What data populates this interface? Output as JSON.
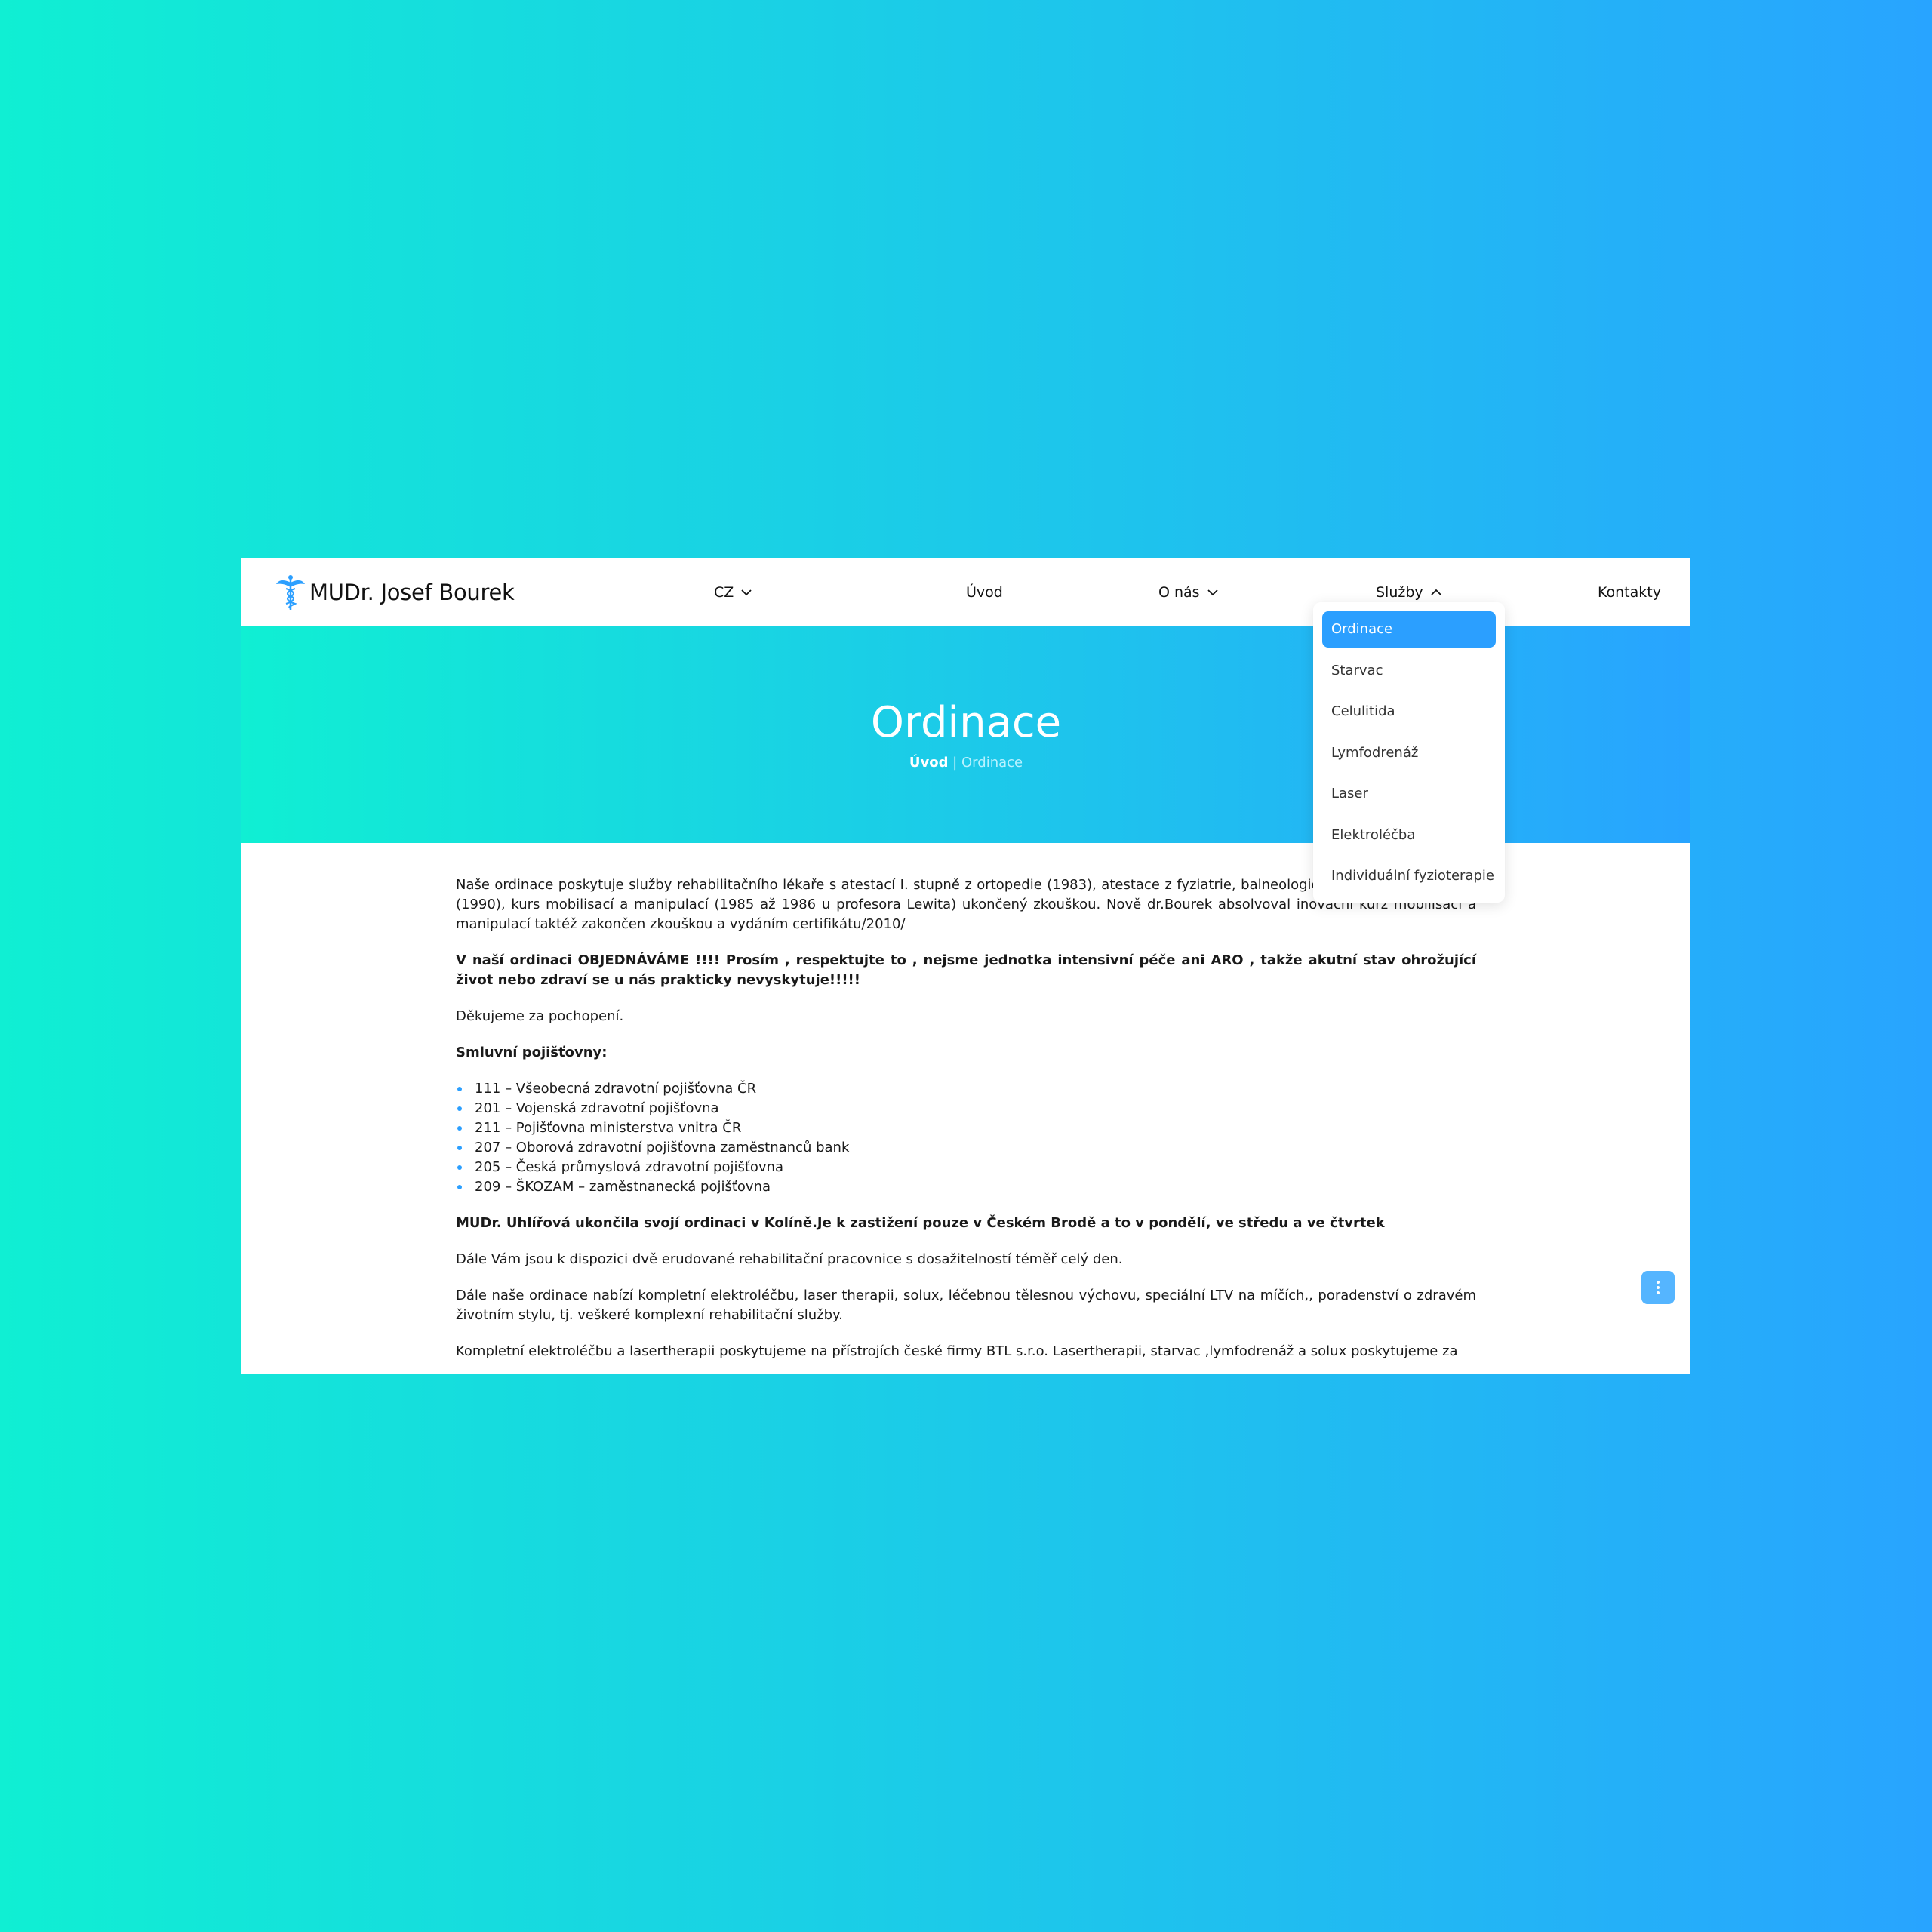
{
  "header": {
    "logo_text": "MUDr. Josef Bourek",
    "nav": {
      "lang": "CZ",
      "home": "Úvod",
      "about": "O nás",
      "services": "Služby",
      "contacts": "Kontakty"
    }
  },
  "dropdown": {
    "items": [
      "Ordinace",
      "Starvac",
      "Celulitida",
      "Lymfodrenáž",
      "Laser",
      "Elektroléčba",
      "Individuální fyzioterapie"
    ],
    "active_index": 0
  },
  "hero": {
    "title": "Ordinace",
    "breadcrumb_home": "Úvod",
    "breadcrumb_sep": " | ",
    "breadcrumb_current": "Ordinace"
  },
  "content": {
    "p1": "Naše ordinace poskytuje služby rehabilitačního lékaře s atestací I. stupně z ortopedie (1983), atestace z fyziatrie, balneologie a léčebné rehabilitace (1990), kurs mobilisací a manipulací (1985 až 1986 u profesora Lewita) ukončený zkouškou. Nově dr.Bourek absolvoval inovační kurz mobilisací a manipulací taktéž zakončen zkouškou a vydáním certifikátu/2010/",
    "p2": "V naší ordinaci OBJEDNÁVÁME !!!! Prosím , respektujte to , nejsme jednotka intensivní péče ani ARO , takže akutní stav ohrožující život nebo zdraví se u nás prakticky nevyskytuje!!!!!",
    "p3": "Děkujeme za pochopení.",
    "insurers_heading": "Smluvní pojišťovny:",
    "insurers": [
      "111 – Všeobecná zdravotní pojišťovna ČR",
      "201 – Vojenská zdravotní pojišťovna",
      "211 – Pojišťovna ministerstva vnitra ČR",
      "207 – Oborová zdravotní pojišťovna zaměstnanců bank",
      "205 – Česká průmyslová zdravotní pojišťovna",
      "209 – ŠKOZAM – zaměstnanecká pojišťovna"
    ],
    "p4": "MUDr. Uhlířová ukončila svojí ordinaci v Kolíně.Je k zastižení pouze v Českém Brodě a to v pondělí, ve středu a ve čtvrtek",
    "p5": "Dále Vám jsou k dispozici dvě erudované rehabilitační pracovnice s dosažitelností téměř celý den.",
    "p6": "Dále naše ordinace nabízí kompletní elektroléčbu, laser therapii, solux, léčebnou tělesnou výchovu, speciální LTV na míčích,, poradenství o zdravém životním stylu, tj. veškeré komplexní rehabilitační služby.",
    "p7": "Kompletní elektroléčbu a lasertherapii poskytujeme na přístrojích české firmy BTL s.r.o. Lasertherapii, starvac ,lymfodrenáž a solux poskytujeme za"
  },
  "colors": {
    "accent": "#2b9fff",
    "gradient_start": "#10efd3",
    "gradient_end": "#28a4ff"
  },
  "icons": {
    "logo": "caduceus-icon",
    "chevron_down": "chevron-down-icon",
    "chevron_up": "chevron-up-icon",
    "fab": "more-vertical-icon"
  }
}
